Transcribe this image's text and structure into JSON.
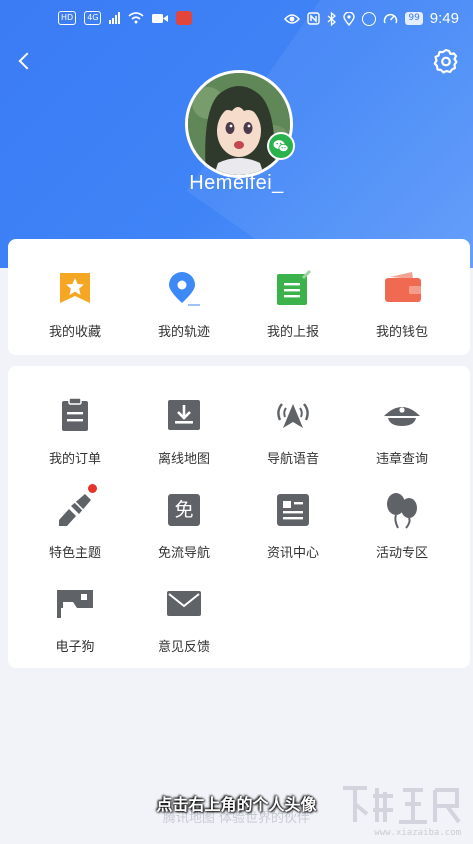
{
  "status_bar": {
    "time": "9:49",
    "battery": "99",
    "left_chips": [
      "HD",
      "4G"
    ],
    "icons": [
      "eye-icon",
      "nfc-icon",
      "bluetooth-icon",
      "location-icon",
      "alarm-icon",
      "speed-icon"
    ]
  },
  "profile": {
    "username": "Hemeifei_",
    "avatar_badge": "wechat-icon"
  },
  "top_shortcuts": [
    {
      "label": "我的收藏",
      "icon": "favorites-star-icon",
      "color": "#f5a623"
    },
    {
      "label": "我的轨迹",
      "icon": "track-location-icon",
      "color": "#3d8af7"
    },
    {
      "label": "我的上报",
      "icon": "report-icon",
      "color": "#3cb34a"
    },
    {
      "label": "我的钱包",
      "icon": "wallet-icon",
      "color": "#f06a52"
    }
  ],
  "menu_items": [
    {
      "label": "我的订单",
      "icon": "order-clipboard-icon"
    },
    {
      "label": "离线地图",
      "icon": "offline-map-download-icon"
    },
    {
      "label": "导航语音",
      "icon": "navigation-voice-icon"
    },
    {
      "label": "违章查询",
      "icon": "police-cap-icon"
    },
    {
      "label": "特色主题",
      "icon": "theme-brush-icon",
      "has_dot": true
    },
    {
      "label": "免流导航",
      "icon": "free-data-icon",
      "glyph": "免"
    },
    {
      "label": "资讯中心",
      "icon": "news-icon"
    },
    {
      "label": "活动专区",
      "icon": "balloons-icon"
    },
    {
      "label": "电子狗",
      "icon": "speed-camera-icon"
    },
    {
      "label": "意见反馈",
      "icon": "feedback-mail-icon"
    }
  ],
  "footer": {
    "text": "腾讯地图 体验世界的伙伴"
  },
  "overlay": {
    "subtitle": "点击右上角的个人头像",
    "watermark_url": "www.xiazaiba.com"
  },
  "colors": {
    "header_blue": "#3b7bf4",
    "icon_gray": "#5f6368",
    "badge_red": "#e8322c"
  }
}
